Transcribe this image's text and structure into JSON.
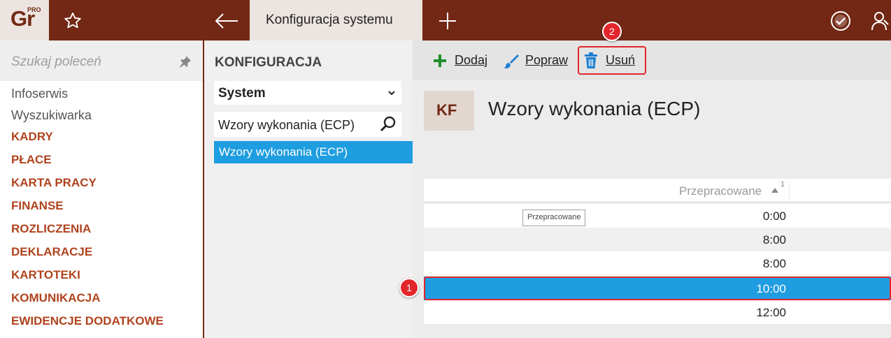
{
  "app": {
    "logo_text": "Gr",
    "logo_sup": "PRO",
    "active_tab": "Konfiguracja systemu"
  },
  "sidebar": {
    "search_placeholder": "Szukaj poleceń",
    "items": [
      {
        "label": "Infoserwis",
        "type": "item"
      },
      {
        "label": "Wyszukiwarka",
        "type": "item"
      },
      {
        "label": "KADRY",
        "type": "category"
      },
      {
        "label": "PŁACE",
        "type": "category"
      },
      {
        "label": "KARTA PRACY",
        "type": "category"
      },
      {
        "label": "FINANSE",
        "type": "category"
      },
      {
        "label": "ROZLICZENIA",
        "type": "category"
      },
      {
        "label": "DEKLARACJE",
        "type": "category"
      },
      {
        "label": "KARTOTEKI",
        "type": "category"
      },
      {
        "label": "KOMUNIKACJA",
        "type": "category"
      },
      {
        "label": "EWIDENCJE DODATKOWE",
        "type": "category"
      }
    ]
  },
  "config_panel": {
    "title": "KONFIGURACJA",
    "selected_group": "System",
    "filter_value": "Wzory wykonania (ECP)",
    "items": [
      {
        "label": "Wzory wykonania (ECP)",
        "selected": true
      }
    ]
  },
  "toolbar": {
    "add_label": "Dodaj",
    "edit_label": "Popraw",
    "delete_label": "Usuń"
  },
  "main": {
    "badge": "KF",
    "title": "Wzory wykonania (ECP)"
  },
  "grid": {
    "column_header": "Przepracowane",
    "sort_index": "1",
    "tooltip": "Przepracowane",
    "rows": [
      "0:00",
      "8:00",
      "8:00",
      "10:00",
      "12:00"
    ],
    "selected_row": 3
  },
  "callouts": {
    "one": "1",
    "two": "2"
  },
  "colors": {
    "brand": "#722814",
    "accent_blue": "#1e9de1",
    "category_text": "#b0431e",
    "callout_red": "#e3262b"
  }
}
